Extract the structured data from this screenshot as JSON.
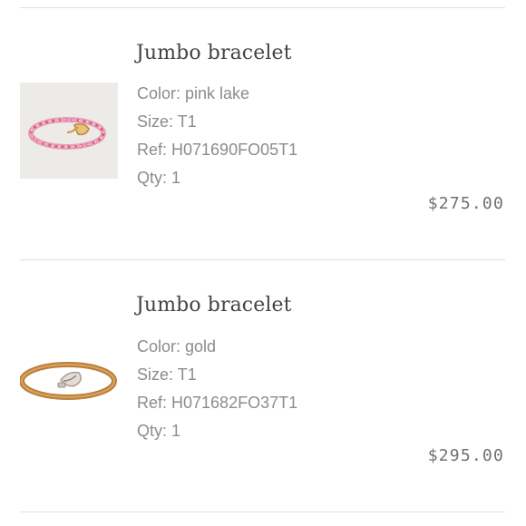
{
  "items": [
    {
      "title": "Jumbo bracelet",
      "color_line": "Color: pink lake",
      "size_line": "Size: T1",
      "ref_line": "Ref: H071690FO05T1",
      "qty_line": "Qty: 1",
      "price": "$275.00",
      "image": {
        "icon": "pink-rope-bracelet-image",
        "background": "#ecebe8"
      }
    },
    {
      "title": "Jumbo bracelet",
      "color_line": "Color: gold",
      "size_line": "Size: T1",
      "ref_line": "Ref: H071682FO37T1",
      "qty_line": "Qty: 1",
      "price": "$295.00",
      "image": {
        "icon": "gold-leather-bracelet-image",
        "background": "#ffffff"
      }
    }
  ],
  "colors": {
    "divider": "#e1e1e1",
    "title_text": "#444444",
    "attr_text": "#8c8c8c",
    "price_text": "#6f6f6f"
  }
}
